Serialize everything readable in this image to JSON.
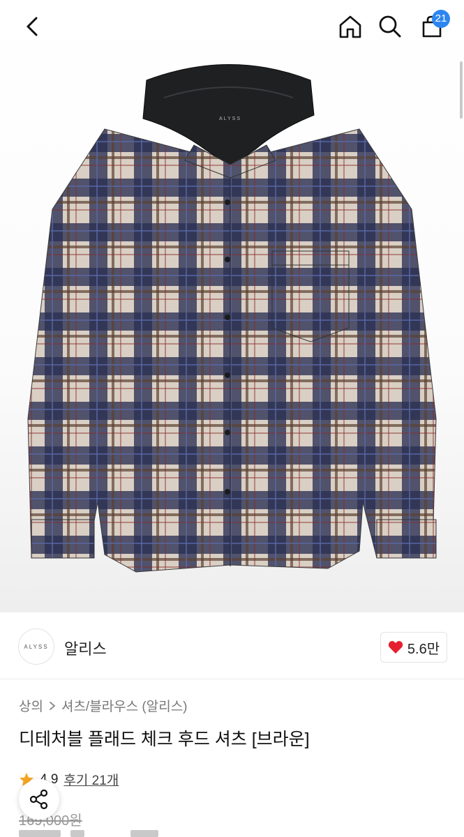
{
  "header": {
    "back_icon": "chevron-left-icon",
    "home_icon": "home-icon",
    "search_icon": "search-icon",
    "cart_icon": "shopping-bag-icon",
    "cart_count": "21"
  },
  "hero": {
    "image_subject": "plaid hooded shirt",
    "logo_text": "ALYSS"
  },
  "brand": {
    "logo_text": "ALYSS",
    "name": "알리스",
    "likes": "5.6만",
    "heart_color": "#e5202e"
  },
  "breadcrumb": {
    "items": [
      "상의",
      "셔츠/블라우스 (알리스)"
    ]
  },
  "product": {
    "title": "디테처블 플래드 체크 후드 셔츠 [브라운]",
    "rating": "4.9",
    "reviews": "후기 21개",
    "original_price": "169,000원"
  },
  "colors": {
    "accent": "#2d86f0",
    "star": "#f5a623"
  }
}
